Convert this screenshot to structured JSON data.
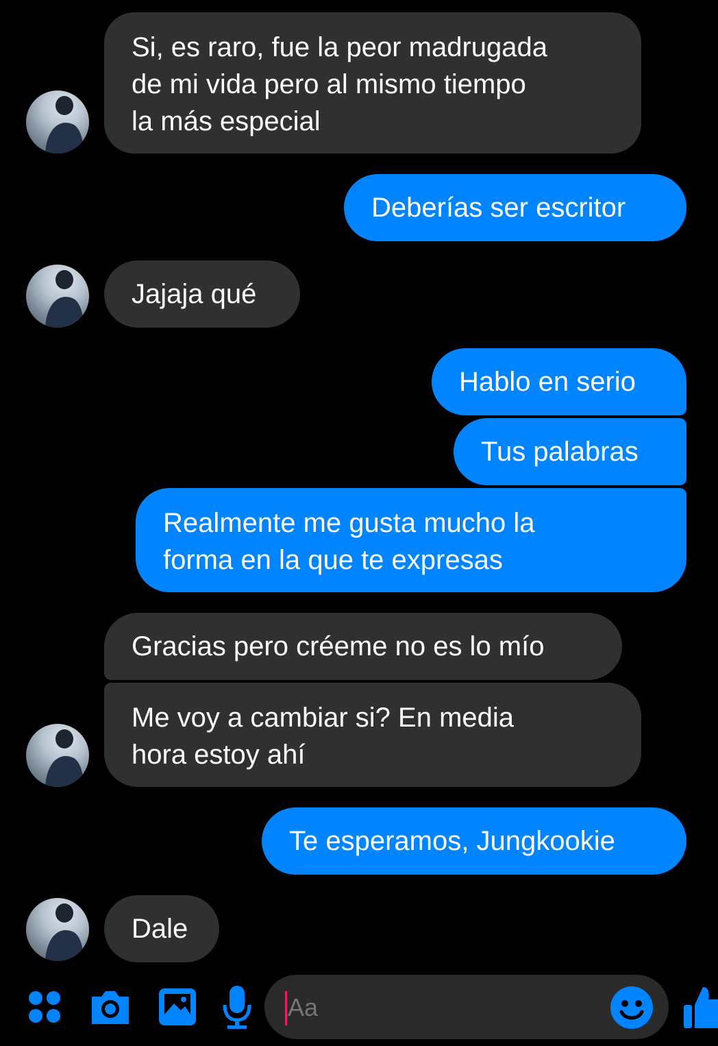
{
  "messages": [
    {
      "side": "in",
      "text": "Si, es raro, fue la peor madrugada\nde mi vida pero al mismo tiempo\nla más especial"
    },
    {
      "side": "out",
      "text": "Deberías ser escritor"
    },
    {
      "side": "in",
      "text": "Jajaja qué"
    },
    {
      "side": "out",
      "text": "Hablo en serio"
    },
    {
      "side": "out",
      "text": "Tus palabras"
    },
    {
      "side": "out",
      "text": "Realmente me gusta mucho la\nforma en la que te expresas"
    },
    {
      "side": "in",
      "text": "Gracias pero créeme no es lo mío"
    },
    {
      "side": "in",
      "text": "Me voy a cambiar si? En media\nhora estoy ahí"
    },
    {
      "side": "out",
      "text": "Te esperamos, Jungkookie"
    },
    {
      "side": "in",
      "text": "Dale"
    }
  ],
  "composer": {
    "placeholder": "Aa",
    "icons": [
      "apps-icon",
      "camera-icon",
      "gallery-icon",
      "microphone-icon",
      "emoji-icon",
      "thumbs-up-icon"
    ]
  },
  "colors": {
    "background": "#000000",
    "incoming_bubble": "#303030",
    "outgoing_bubble": "#0084ff",
    "accent": "#0084ff"
  }
}
